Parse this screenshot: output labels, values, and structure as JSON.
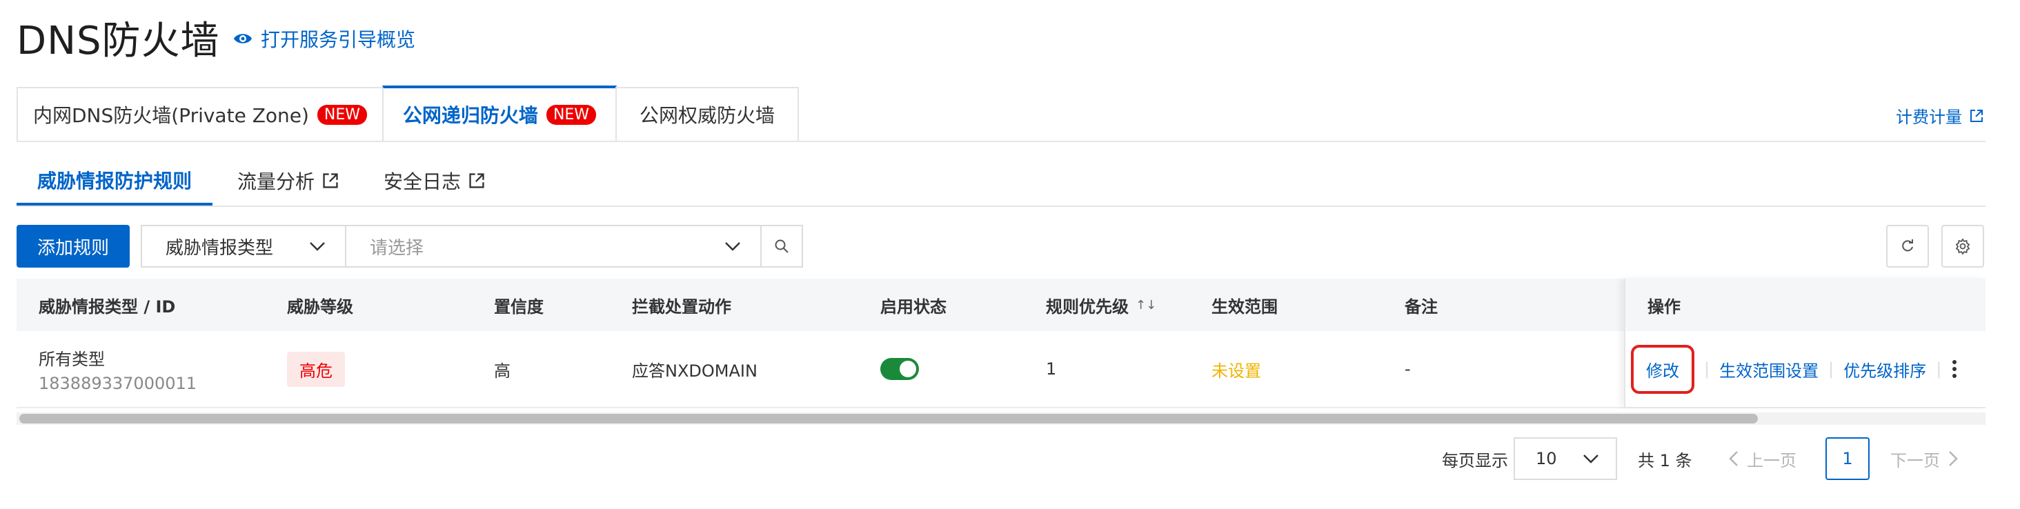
{
  "header": {
    "title": "DNS防火墙",
    "guide_label": "打开服务引导概览"
  },
  "tabs": [
    {
      "label": "内网DNS防火墙(Private Zone)",
      "badge": "NEW"
    },
    {
      "label": "公网递归防火墙",
      "badge": "NEW",
      "active": true
    },
    {
      "label": "公网权威防火墙"
    }
  ],
  "billing_label": "计费计量",
  "subtabs": [
    {
      "label": "威胁情报防护规则",
      "active": true
    },
    {
      "label": "流量分析"
    },
    {
      "label": "安全日志"
    }
  ],
  "toolbar": {
    "add_label": "添加规则",
    "filter_type": "威胁情报类型",
    "filter_placeholder": "请选择"
  },
  "table": {
    "columns": [
      "威胁情报类型 / ID",
      "威胁等级",
      "置信度",
      "拦截处置动作",
      "启用状态",
      "规则优先级",
      "生效范围",
      "备注",
      "操作"
    ],
    "sort_glyph": "↑↓",
    "rows": [
      {
        "type": "所有类型",
        "id": "183889337000011",
        "level": "高危",
        "confidence": "高",
        "action": "应答NXDOMAIN",
        "enabled": true,
        "priority": "1",
        "scope": "未设置",
        "note": "-",
        "ops": [
          "修改",
          "生效范围设置",
          "优先级排序"
        ]
      }
    ]
  },
  "pagination": {
    "per_page_label": "每页显示",
    "per_page": "10",
    "total": "共 1 条",
    "prev": "上一页",
    "current": "1",
    "next": "下一页"
  },
  "colors": {
    "accent": "#0064c8",
    "danger": "#e00000",
    "scope": "#f0b400",
    "toggle_on": "#1a8a3a"
  }
}
